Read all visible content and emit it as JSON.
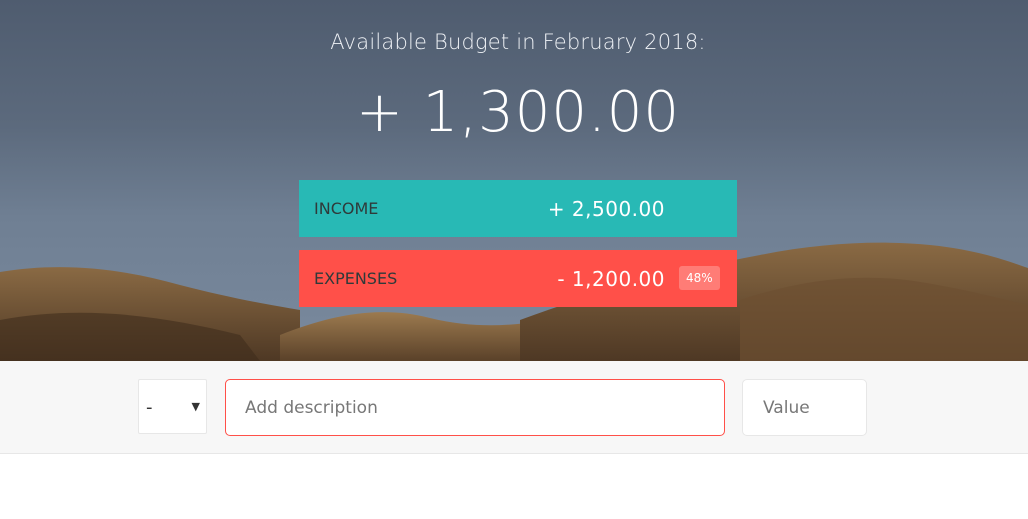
{
  "budget": {
    "title": "Available Budget in February 2018:",
    "value": "+ 1,300.00"
  },
  "income": {
    "label": "Income",
    "value": "+ 2,500.00",
    "color": "#28b9b5"
  },
  "expenses": {
    "label": "Expenses",
    "value": "- 1,200.00",
    "percentage": "48%",
    "color": "#ff5049"
  },
  "add_form": {
    "type_selected": "-",
    "type_arrow_icon": "caret-down-icon",
    "description_placeholder": "Add description",
    "value_placeholder": "Value",
    "focus_color": "#ff5049"
  }
}
